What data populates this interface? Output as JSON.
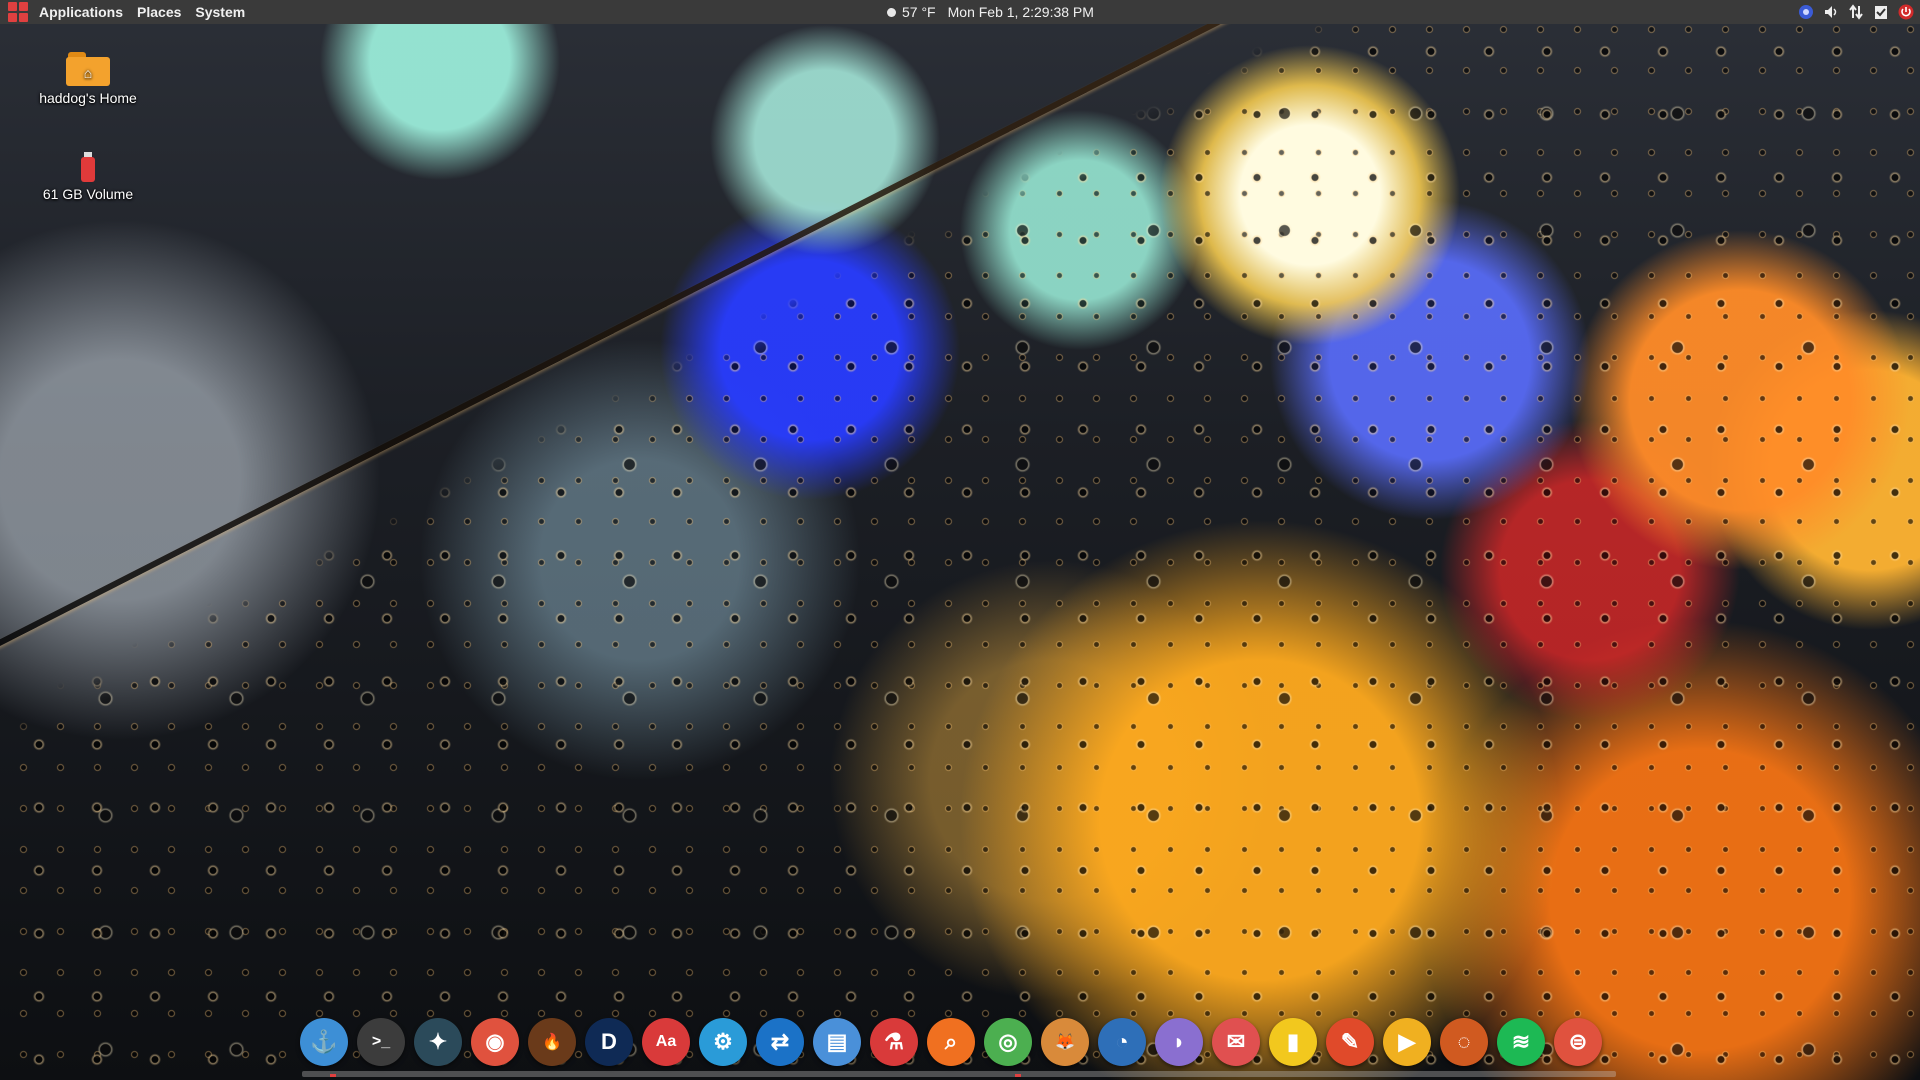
{
  "top_panel": {
    "menus": [
      "Applications",
      "Places",
      "System"
    ],
    "weather": "57 °F",
    "clock": "Mon Feb  1, 2:29:38 PM",
    "tray_icons": [
      "network-icon",
      "volume-icon",
      "transfer-icon",
      "clipboard-icon",
      "power-icon"
    ]
  },
  "desktop": {
    "icons": [
      {
        "label": "haddog's Home",
        "icon": "home-folder-icon"
      },
      {
        "label": "61 GB Volume",
        "icon": "usb-drive-icon"
      }
    ]
  },
  "dock": {
    "items": [
      {
        "icon": "anchor-icon",
        "glyph": "⚓",
        "color": "#3d8fd6"
      },
      {
        "icon": "terminal-icon",
        "glyph": ">_",
        "color": "#3c3c3c"
      },
      {
        "icon": "kodi-icon",
        "glyph": "✦",
        "color": "#2b4a5a"
      },
      {
        "icon": "camera-icon",
        "glyph": "◉",
        "color": "#e0523e"
      },
      {
        "icon": "flame-icon",
        "glyph": "🔥",
        "color": "#6a3a1a"
      },
      {
        "icon": "dict-icon",
        "glyph": "D",
        "color": "#0f2a55"
      },
      {
        "icon": "font-icon",
        "glyph": "Aa",
        "color": "#d93a3a"
      },
      {
        "icon": "settings-icon",
        "glyph": "⚙",
        "color": "#2a9bd8"
      },
      {
        "icon": "teamviewer-icon",
        "glyph": "⇄",
        "color": "#1b72c7"
      },
      {
        "icon": "archive-icon",
        "glyph": "▤",
        "color": "#4a90d9"
      },
      {
        "icon": "inspector-icon",
        "glyph": "⚗",
        "color": "#d93a3a"
      },
      {
        "icon": "search-icon",
        "glyph": "⌕",
        "color": "#f07020"
      },
      {
        "icon": "chrome-icon",
        "glyph": "◎",
        "color": "#4caf50"
      },
      {
        "icon": "gimp-icon",
        "glyph": "🦊",
        "color": "#d98a3a"
      },
      {
        "icon": "firefox-icon",
        "glyph": "◔",
        "color": "#2e6fb8"
      },
      {
        "icon": "chat-icon",
        "glyph": "◗",
        "color": "#8a6fd0"
      },
      {
        "icon": "mail-icon",
        "glyph": "✉",
        "color": "#e05050"
      },
      {
        "icon": "battery-icon",
        "glyph": "▮",
        "color": "#f2c81e"
      },
      {
        "icon": "color-picker-icon",
        "glyph": "✎",
        "color": "#e04a2a"
      },
      {
        "icon": "play-icon",
        "glyph": "▶",
        "color": "#f0b020"
      },
      {
        "icon": "blender-icon",
        "glyph": "◌",
        "color": "#d05a20"
      },
      {
        "icon": "spotify-icon",
        "glyph": "≋",
        "color": "#1db954"
      },
      {
        "icon": "toggle-icon",
        "glyph": "⊜",
        "color": "#e0523e"
      }
    ]
  }
}
